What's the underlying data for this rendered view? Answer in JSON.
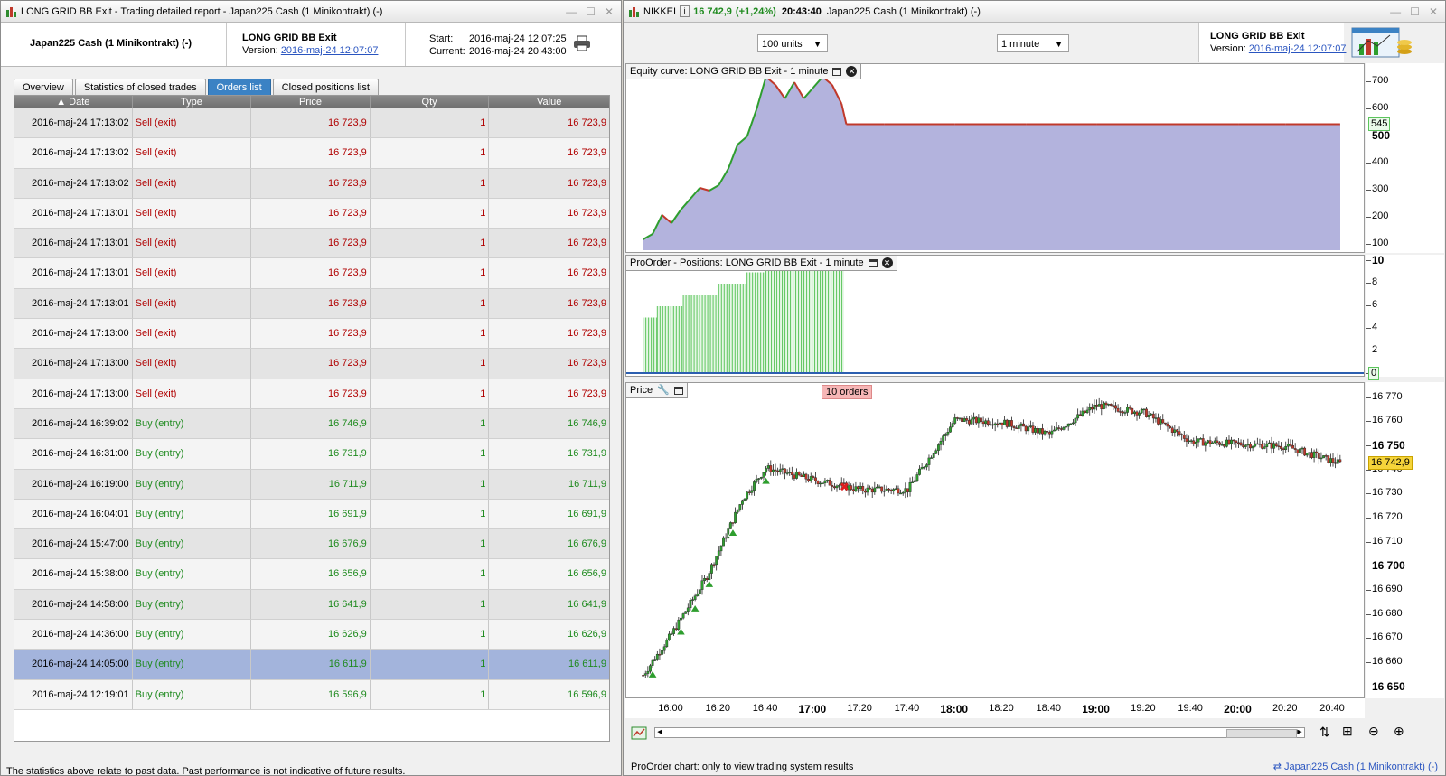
{
  "left_window": {
    "title": "LONG GRID BB Exit - Trading detailed report - Japan225 Cash (1 Minikontrakt) (-)",
    "instrument": "Japan225 Cash (1 Minikontrakt) (-)",
    "strategy_name": "LONG GRID BB Exit",
    "version_label": "Version:",
    "version_value": "2016-maj-24 12:07:07",
    "start_label": "Start:",
    "start_value": "2016-maj-24 12:07:25",
    "current_label": "Current:",
    "current_value": "2016-maj-24 20:43:00",
    "tabs": [
      "Overview",
      "Statistics of closed trades",
      "Orders list",
      "Closed positions list"
    ],
    "active_tab": "Orders list",
    "columns": [
      "Date",
      "Type",
      "Price",
      "Qty",
      "Value"
    ],
    "rows": [
      {
        "date": "2016-maj-24 17:13:02",
        "type": "Sell (exit)",
        "price": "16 723,9",
        "qty": "1",
        "value": "16 723,9",
        "side": "sell"
      },
      {
        "date": "2016-maj-24 17:13:02",
        "type": "Sell (exit)",
        "price": "16 723,9",
        "qty": "1",
        "value": "16 723,9",
        "side": "sell"
      },
      {
        "date": "2016-maj-24 17:13:02",
        "type": "Sell (exit)",
        "price": "16 723,9",
        "qty": "1",
        "value": "16 723,9",
        "side": "sell"
      },
      {
        "date": "2016-maj-24 17:13:01",
        "type": "Sell (exit)",
        "price": "16 723,9",
        "qty": "1",
        "value": "16 723,9",
        "side": "sell"
      },
      {
        "date": "2016-maj-24 17:13:01",
        "type": "Sell (exit)",
        "price": "16 723,9",
        "qty": "1",
        "value": "16 723,9",
        "side": "sell"
      },
      {
        "date": "2016-maj-24 17:13:01",
        "type": "Sell (exit)",
        "price": "16 723,9",
        "qty": "1",
        "value": "16 723,9",
        "side": "sell"
      },
      {
        "date": "2016-maj-24 17:13:01",
        "type": "Sell (exit)",
        "price": "16 723,9",
        "qty": "1",
        "value": "16 723,9",
        "side": "sell"
      },
      {
        "date": "2016-maj-24 17:13:00",
        "type": "Sell (exit)",
        "price": "16 723,9",
        "qty": "1",
        "value": "16 723,9",
        "side": "sell"
      },
      {
        "date": "2016-maj-24 17:13:00",
        "type": "Sell (exit)",
        "price": "16 723,9",
        "qty": "1",
        "value": "16 723,9",
        "side": "sell"
      },
      {
        "date": "2016-maj-24 17:13:00",
        "type": "Sell (exit)",
        "price": "16 723,9",
        "qty": "1",
        "value": "16 723,9",
        "side": "sell"
      },
      {
        "date": "2016-maj-24 16:39:02",
        "type": "Buy (entry)",
        "price": "16 746,9",
        "qty": "1",
        "value": "16 746,9",
        "side": "buy"
      },
      {
        "date": "2016-maj-24 16:31:00",
        "type": "Buy (entry)",
        "price": "16 731,9",
        "qty": "1",
        "value": "16 731,9",
        "side": "buy"
      },
      {
        "date": "2016-maj-24 16:19:00",
        "type": "Buy (entry)",
        "price": "16 711,9",
        "qty": "1",
        "value": "16 711,9",
        "side": "buy"
      },
      {
        "date": "2016-maj-24 16:04:01",
        "type": "Buy (entry)",
        "price": "16 691,9",
        "qty": "1",
        "value": "16 691,9",
        "side": "buy"
      },
      {
        "date": "2016-maj-24 15:47:00",
        "type": "Buy (entry)",
        "price": "16 676,9",
        "qty": "1",
        "value": "16 676,9",
        "side": "buy"
      },
      {
        "date": "2016-maj-24 15:38:00",
        "type": "Buy (entry)",
        "price": "16 656,9",
        "qty": "1",
        "value": "16 656,9",
        "side": "buy"
      },
      {
        "date": "2016-maj-24 14:58:00",
        "type": "Buy (entry)",
        "price": "16 641,9",
        "qty": "1",
        "value": "16 641,9",
        "side": "buy"
      },
      {
        "date": "2016-maj-24 14:36:00",
        "type": "Buy (entry)",
        "price": "16 626,9",
        "qty": "1",
        "value": "16 626,9",
        "side": "buy"
      },
      {
        "date": "2016-maj-24 14:05:00",
        "type": "Buy (entry)",
        "price": "16 611,9",
        "qty": "1",
        "value": "16 611,9",
        "side": "buy"
      },
      {
        "date": "2016-maj-24 12:19:01",
        "type": "Buy (entry)",
        "price": "16 596,9",
        "qty": "1",
        "value": "16 596,9",
        "side": "buy"
      }
    ],
    "selected_row_index": 18,
    "footer": "The statistics above relate to past data. Past performance is not indicative of future results."
  },
  "right_window": {
    "symbol": "NIKKEI",
    "last_price": "16 742,9",
    "change": "(+1,24%)",
    "time": "20:43:40",
    "instrument": "Japan225 Cash (1 Minikontrakt) (-)",
    "units_select": "100 units",
    "interval_select": "1 minute",
    "strategy_name": "LONG GRID BB Exit",
    "version_label": "Version:",
    "version_value": "2016-maj-24 12:07:07",
    "equity_title": "Equity curve: LONG GRID BB Exit - 1 minute",
    "positions_title": "ProOrder - Positions: LONG GRID BB Exit - 1 minute",
    "price_title": "Price",
    "orders_badge": "10 orders",
    "equity_current_label": "545",
    "positions_current_label": "0",
    "price_current_label": "16 742,9",
    "status_left": "ProOrder chart: only to view trading system results",
    "status_right": "Japan225 Cash (1 Minikontrakt) (-)",
    "colors": {
      "up": "#2e9e2e",
      "down": "#c0392b",
      "equity_fill": "#b3b3dd",
      "positions_bar": "#5cc55c",
      "accent_blue": "#2c5fb0"
    }
  },
  "chart_data": [
    {
      "type": "area",
      "title": "Equity curve: LONG GRID BB Exit - 1 minute",
      "x": [
        "15:48",
        "15:52",
        "15:56",
        "16:00",
        "16:04",
        "16:08",
        "16:12",
        "16:16",
        "16:20",
        "16:24",
        "16:28",
        "16:32",
        "16:36",
        "16:40",
        "16:44",
        "16:48",
        "16:52",
        "16:56",
        "17:00",
        "17:04",
        "17:08",
        "17:12",
        "17:14",
        "17:30",
        "18:00",
        "18:30",
        "19:00",
        "19:30",
        "20:00",
        "20:20",
        "20:43"
      ],
      "y": [
        120,
        140,
        210,
        180,
        230,
        270,
        310,
        300,
        320,
        380,
        470,
        500,
        600,
        720,
        690,
        640,
        700,
        640,
        680,
        720,
        690,
        620,
        545,
        545,
        545,
        545,
        545,
        545,
        545,
        545,
        545
      ],
      "ylim": [
        80,
        740
      ],
      "yticks": [
        100,
        200,
        300,
        400,
        500,
        600,
        700
      ],
      "current": 545
    },
    {
      "type": "bar",
      "title": "ProOrder - Positions: LONG GRID BB Exit - 1 minute",
      "segments": [
        {
          "from": "15:48",
          "to": "15:54",
          "value": 5
        },
        {
          "from": "15:54",
          "to": "16:05",
          "value": 6
        },
        {
          "from": "16:05",
          "to": "16:20",
          "value": 7
        },
        {
          "from": "16:20",
          "to": "16:32",
          "value": 8
        },
        {
          "from": "16:32",
          "to": "16:40",
          "value": 9
        },
        {
          "from": "16:40",
          "to": "17:13",
          "value": 10
        }
      ],
      "ylim": [
        0,
        10
      ],
      "yticks": [
        0,
        2,
        4,
        6,
        8,
        10
      ],
      "current": 0
    },
    {
      "type": "candlestick",
      "title": "Price",
      "x_labels": [
        "16:00",
        "16:20",
        "16:40",
        "17:00",
        "17:20",
        "17:40",
        "18:00",
        "18:20",
        "18:40",
        "19:00",
        "19:20",
        "19:40",
        "20:00",
        "20:20",
        "20:40"
      ],
      "bold_x_labels": [
        "17:00",
        "18:00",
        "19:00",
        "20:00"
      ],
      "key_prices": [
        {
          "time": "15:48",
          "price": 16655
        },
        {
          "time": "16:00",
          "price": 16672
        },
        {
          "time": "16:15",
          "price": 16696
        },
        {
          "time": "16:30",
          "price": 16728
        },
        {
          "time": "16:40",
          "price": 16741
        },
        {
          "time": "17:00",
          "price": 16736
        },
        {
          "time": "17:20",
          "price": 16732
        },
        {
          "time": "17:40",
          "price": 16732
        },
        {
          "time": "18:00",
          "price": 16761
        },
        {
          "time": "18:20",
          "price": 16760
        },
        {
          "time": "18:40",
          "price": 16755
        },
        {
          "time": "19:00",
          "price": 16767
        },
        {
          "time": "19:20",
          "price": 16764
        },
        {
          "time": "19:40",
          "price": 16752
        },
        {
          "time": "20:00",
          "price": 16751
        },
        {
          "time": "20:20",
          "price": 16750
        },
        {
          "time": "20:43",
          "price": 16742.9
        }
      ],
      "ylim": [
        16648,
        16774
      ],
      "yticks": [
        16650,
        16660,
        16670,
        16680,
        16690,
        16700,
        16710,
        16720,
        16730,
        16740,
        16750,
        16760,
        16770
      ],
      "bold_yticks": [
        16650,
        16700,
        16750
      ],
      "current": 16742.9
    }
  ]
}
